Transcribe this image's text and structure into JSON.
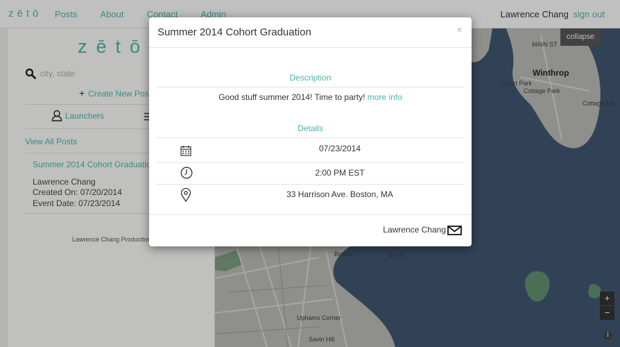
{
  "nav": {
    "brand": "zētō",
    "links": [
      "Posts",
      "About",
      "Contact",
      "Admin"
    ],
    "user_name": "Lawrence Chang",
    "sign_out": "sign out"
  },
  "sidebar": {
    "logo": "zētō",
    "search_placeholder": "city, state",
    "create_post": "Create New Post",
    "tab_launchers": "Launchers",
    "view_all": "View All Posts",
    "post": {
      "title": "Summer 2014 Cohort Graduation",
      "author": "Lawrence Chang",
      "created": "Created On: 07/20/2014",
      "event_date": "Event Date: 07/23/2014"
    },
    "footer_credit": "Lawrence Chang Production"
  },
  "map": {
    "collapse": "collapse",
    "zoom_in": "+",
    "zoom_out": "−",
    "info": "i",
    "labels": {
      "winthrop": "Winthrop",
      "main_st": "MAIN ST",
      "court_park": "Court Park",
      "cottage_park": "Cottage Park",
      "cottage_hill": "Cottage Hill",
      "boston": "Boston",
      "uphams_corner": "Uphams Corner",
      "savin_hill": "Savin Hill",
      "e_st": "E ST"
    }
  },
  "modal": {
    "title": "Summer 2014 Cohort Graduation",
    "close": "×",
    "description_heading": "Description",
    "description": "Good stuff summer 2014! Time to party!",
    "more_info": "more info",
    "details_heading": "Details",
    "date": "07/23/2014",
    "time": "2:00 PM EST",
    "address": "33 Harrison Ave. Boston, MA",
    "author": "Lawrence Chang"
  },
  "colors": {
    "accent": "#4bb3a7",
    "water": "#3f5570",
    "land": "#b8b8b2",
    "park": "#5f8f6e"
  },
  "icons": [
    "search-icon",
    "plus-icon",
    "user-icon",
    "list-icon",
    "calendar-icon",
    "clock-icon",
    "map-pin-icon",
    "mail-icon",
    "close-icon",
    "info-icon"
  ]
}
